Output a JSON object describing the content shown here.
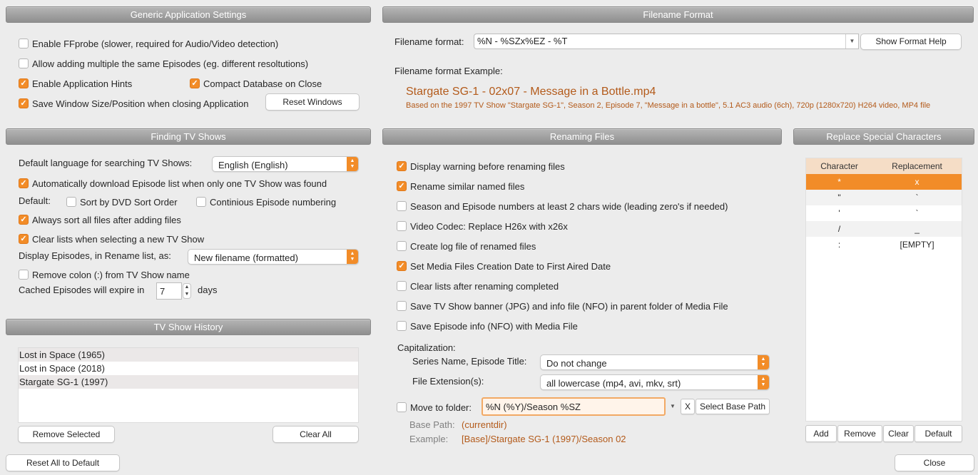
{
  "generic": {
    "header": "Generic Application Settings",
    "ffprobe": "Enable FFprobe (slower, required for Audio/Video detection)",
    "multiple": "Allow adding multiple the same Episodes (eg. different resoltutions)",
    "hints": "Enable Application Hints",
    "compact": "Compact Database on Close",
    "savewin": "Save Window Size/Position when closing Application",
    "reset_windows": "Reset Windows"
  },
  "filename_format": {
    "header": "Filename Format",
    "label": "Filename format:",
    "value": "%N - %SZx%EZ - %T",
    "help": "Show Format Help",
    "example_label": "Filename format Example:",
    "example": "Stargate SG-1 - 02x07 - Message in a Bottle.mp4",
    "based_on": "Based on the 1997 TV Show \"Stargate SG-1\", Season 2, Episode 7, \"Message in a bottle\", 5.1 AC3 audio (6ch), 720p (1280x720) H264 video, MP4 file"
  },
  "finding": {
    "header": "Finding TV Shows",
    "lang_label": "Default language for searching TV Shows:",
    "lang_value": "English (English)",
    "autodl": "Automatically download Episode list when only one TV Show was found",
    "default_label": "Default:",
    "dvd": "Sort by DVD Sort Order",
    "contin": "Continious Episode numbering",
    "always_sort": "Always sort all files after adding files",
    "clear_lists": "Clear lists when selecting a new TV Show",
    "display_label": "Display Episodes, in Rename list, as:",
    "display_value": "New filename (formatted)",
    "remove_colon": "Remove colon (:) from TV Show name",
    "cache_label": "Cached Episodes will expire in",
    "cache_value": "7",
    "cache_unit": "days"
  },
  "history": {
    "header": "TV Show History",
    "items": [
      "Lost in Space (1965)",
      "Lost in Space (2018)",
      "Stargate SG-1 (1997)"
    ],
    "remove": "Remove Selected",
    "clear": "Clear All"
  },
  "renaming": {
    "header": "Renaming Files",
    "options": [
      {
        "label": "Display warning before renaming files",
        "checked": true
      },
      {
        "label": "Rename similar named files",
        "checked": true
      },
      {
        "label": "Season and Episode numbers at least 2 chars wide (leading zero's if needed)",
        "checked": false
      },
      {
        "label": "Video Codec: Replace H26x with x26x",
        "checked": false
      },
      {
        "label": "Create log file of renamed files",
        "checked": false
      },
      {
        "label": "Set Media Files Creation Date to First Aired Date",
        "checked": true
      },
      {
        "label": "Clear lists after renaming completed",
        "checked": false
      },
      {
        "label": "Save TV Show banner (JPG) and info file (NFO) in parent folder of Media File",
        "checked": false
      },
      {
        "label": "Save Episode info (NFO) with Media File",
        "checked": false
      }
    ],
    "cap_label": "Capitalization:",
    "series_label": "Series Name, Episode Title:",
    "series_value": "Do not change",
    "ext_label": "File Extension(s):",
    "ext_value": "all lowercase (mp4, avi, mkv, srt)",
    "move_label": "Move to folder:",
    "move_value": "%N (%Y)/Season %SZ",
    "x_button": "X",
    "select_base": "Select Base Path",
    "base_label": "Base Path:",
    "base_value": "(currentdir)",
    "example_label": "Example:",
    "example_value": "[Base]/Stargate SG-1 (1997)/Season 02"
  },
  "special": {
    "header": "Replace Special Characters",
    "col_char": "Character",
    "col_repl": "Replacement",
    "rows": [
      {
        "c": "*",
        "r": "x"
      },
      {
        "c": "\"",
        "r": "`"
      },
      {
        "c": "'",
        "r": "`"
      },
      {
        "c": "/",
        "r": "_"
      },
      {
        "c": ":",
        "r": "[EMPTY]"
      }
    ],
    "add": "Add",
    "remove": "Remove",
    "clear": "Clear",
    "default": "Default"
  },
  "footer": {
    "reset_all": "Reset All to Default",
    "close": "Close"
  },
  "colors": {
    "accent": "#f28c28",
    "orange_text": "#b35a1a"
  }
}
